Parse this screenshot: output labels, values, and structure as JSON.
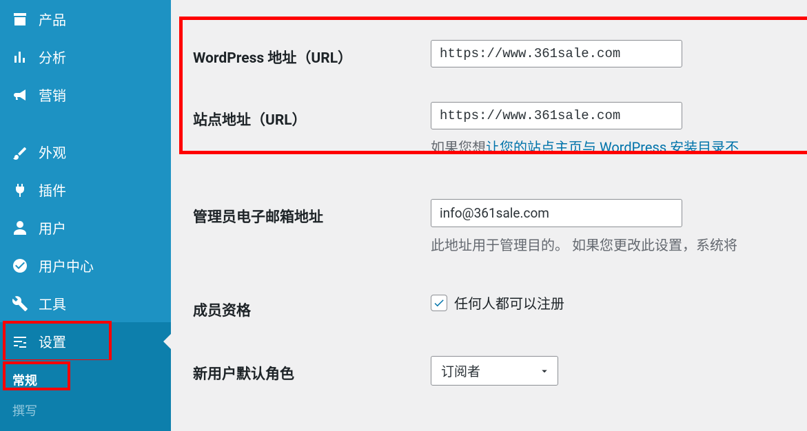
{
  "sidebar": {
    "items": [
      {
        "label": "产品",
        "icon": "archive-icon"
      },
      {
        "label": "分析",
        "icon": "chart-icon"
      },
      {
        "label": "营销",
        "icon": "megaphone-icon"
      },
      {
        "label": "外观",
        "icon": "brush-icon"
      },
      {
        "label": "插件",
        "icon": "plug-icon"
      },
      {
        "label": "用户",
        "icon": "user-icon"
      },
      {
        "label": "用户中心",
        "icon": "check-circle-icon"
      },
      {
        "label": "工具",
        "icon": "wrench-icon"
      },
      {
        "label": "设置",
        "icon": "sliders-icon"
      }
    ],
    "submenu": [
      {
        "label": "常规"
      },
      {
        "label": "撰写"
      }
    ]
  },
  "form": {
    "wp_url": {
      "label": "WordPress 地址（URL）",
      "value": "https://www.361sale.com"
    },
    "site_url": {
      "label": "站点地址（URL）",
      "value": "https://www.361sale.com",
      "desc_prefix": "如果您想",
      "desc_link": "让您的站点主页与 WordPress 安装目录不"
    },
    "admin_email": {
      "label": "管理员电子邮箱地址",
      "value": "info@361sale.com",
      "desc": "此地址用于管理目的。 如果您更改此设置，系统将"
    },
    "membership": {
      "label": "成员资格",
      "checkbox_label": "任何人都可以注册"
    },
    "default_role": {
      "label": "新用户默认角色",
      "value": "订阅者"
    }
  }
}
